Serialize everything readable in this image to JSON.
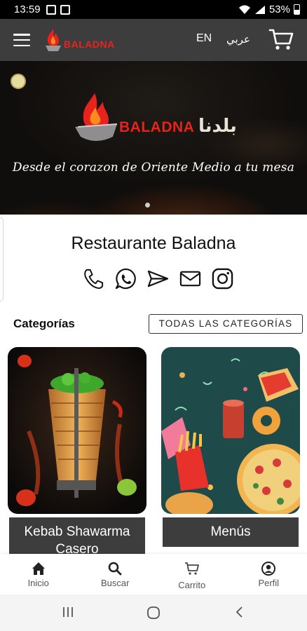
{
  "status_bar": {
    "time": "13:59",
    "battery": "53%"
  },
  "top_bar": {
    "logo_text": "BALADNA",
    "lang_en": "EN",
    "lang_ar": "عربي"
  },
  "hero": {
    "brand": "BALADNA",
    "brand_ar": "بلدنا",
    "tagline": "Desde el corazon de Oriente Medio a tu mesa",
    "carousel_count": 1
  },
  "restaurant": {
    "name": "Restaurante Baladna",
    "contacts": [
      "phone-icon",
      "whatsapp-icon",
      "send-icon",
      "mail-icon",
      "instagram-icon"
    ]
  },
  "categories": {
    "heading": "Categorías",
    "all_button": "TODAS LAS CATEGORÍAS",
    "items": [
      {
        "label": "Kebab Shawarma Casero"
      },
      {
        "label": "Menús"
      }
    ]
  },
  "bottom_nav": {
    "items": [
      {
        "label": "Inicio",
        "icon": "home-icon"
      },
      {
        "label": "Buscar",
        "icon": "search-icon"
      },
      {
        "label": "Carrito",
        "icon": "cart-icon"
      },
      {
        "label": "Perfil",
        "icon": "profile-icon"
      }
    ]
  },
  "colors": {
    "brand_red": "#e8231d",
    "bar_dark": "#3d3d3d"
  }
}
